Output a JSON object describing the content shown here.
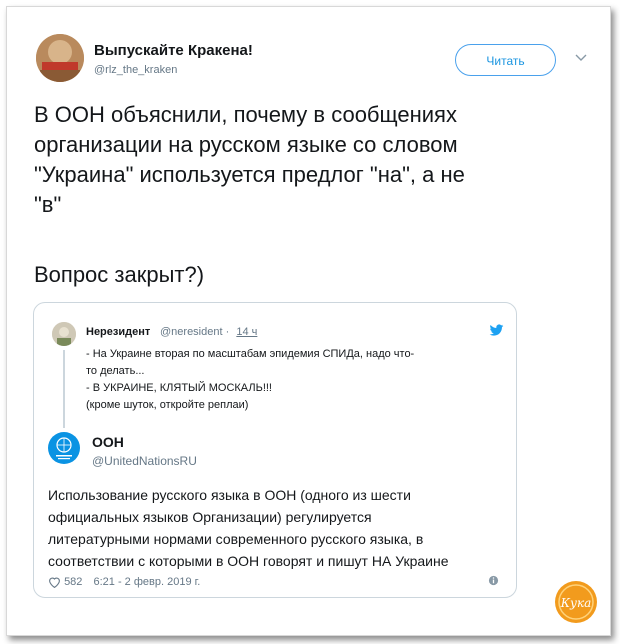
{
  "author": {
    "name": "Выпускайте Кракена!",
    "handle": "@rlz_the_kraken"
  },
  "follow_label": "Читать",
  "tweet_lines": [
    "В ООН объяснили, почему в сообщениях",
    "организации на русском языке со словом",
    "\"Украина\" используется предлог \"на\", а не",
    "\"в\""
  ],
  "tweet_question": "Вопрос закрыт?)",
  "quoted": {
    "name": "Нерезидент",
    "handle": "@neresident",
    "time": "14 ч",
    "lines": [
      "- На Украине вторая по масштабам эпидемия СПИДа, надо что-",
      "то делать...",
      "- В УКРАИНЕ, КЛЯТЫЙ МОСКАЛЬ!!!",
      "(кроме шуток, откройте реплаи)"
    ]
  },
  "reply": {
    "name": "ООН",
    "handle": "@UnitedNationsRU",
    "lines": [
      "Использование русского языка в ООН (одного из шести",
      "официальных языков Организации) регулируется",
      "литературными нормами современного русского языка, в",
      "соответствии с которыми в ООН говорят и пишут НА Украине"
    ],
    "likes": "582",
    "date": "6:21 - 2 февр. 2019 г."
  },
  "watermark": "Кука",
  "colors": {
    "accent": "#1da1f2",
    "un_blue": "#0a93e3",
    "watermark": "#f29b1d"
  },
  "icons": {
    "chevron": "chevron-down-icon",
    "bird": "twitter-bird-icon",
    "heart": "heart-icon",
    "info": "info-icon"
  }
}
